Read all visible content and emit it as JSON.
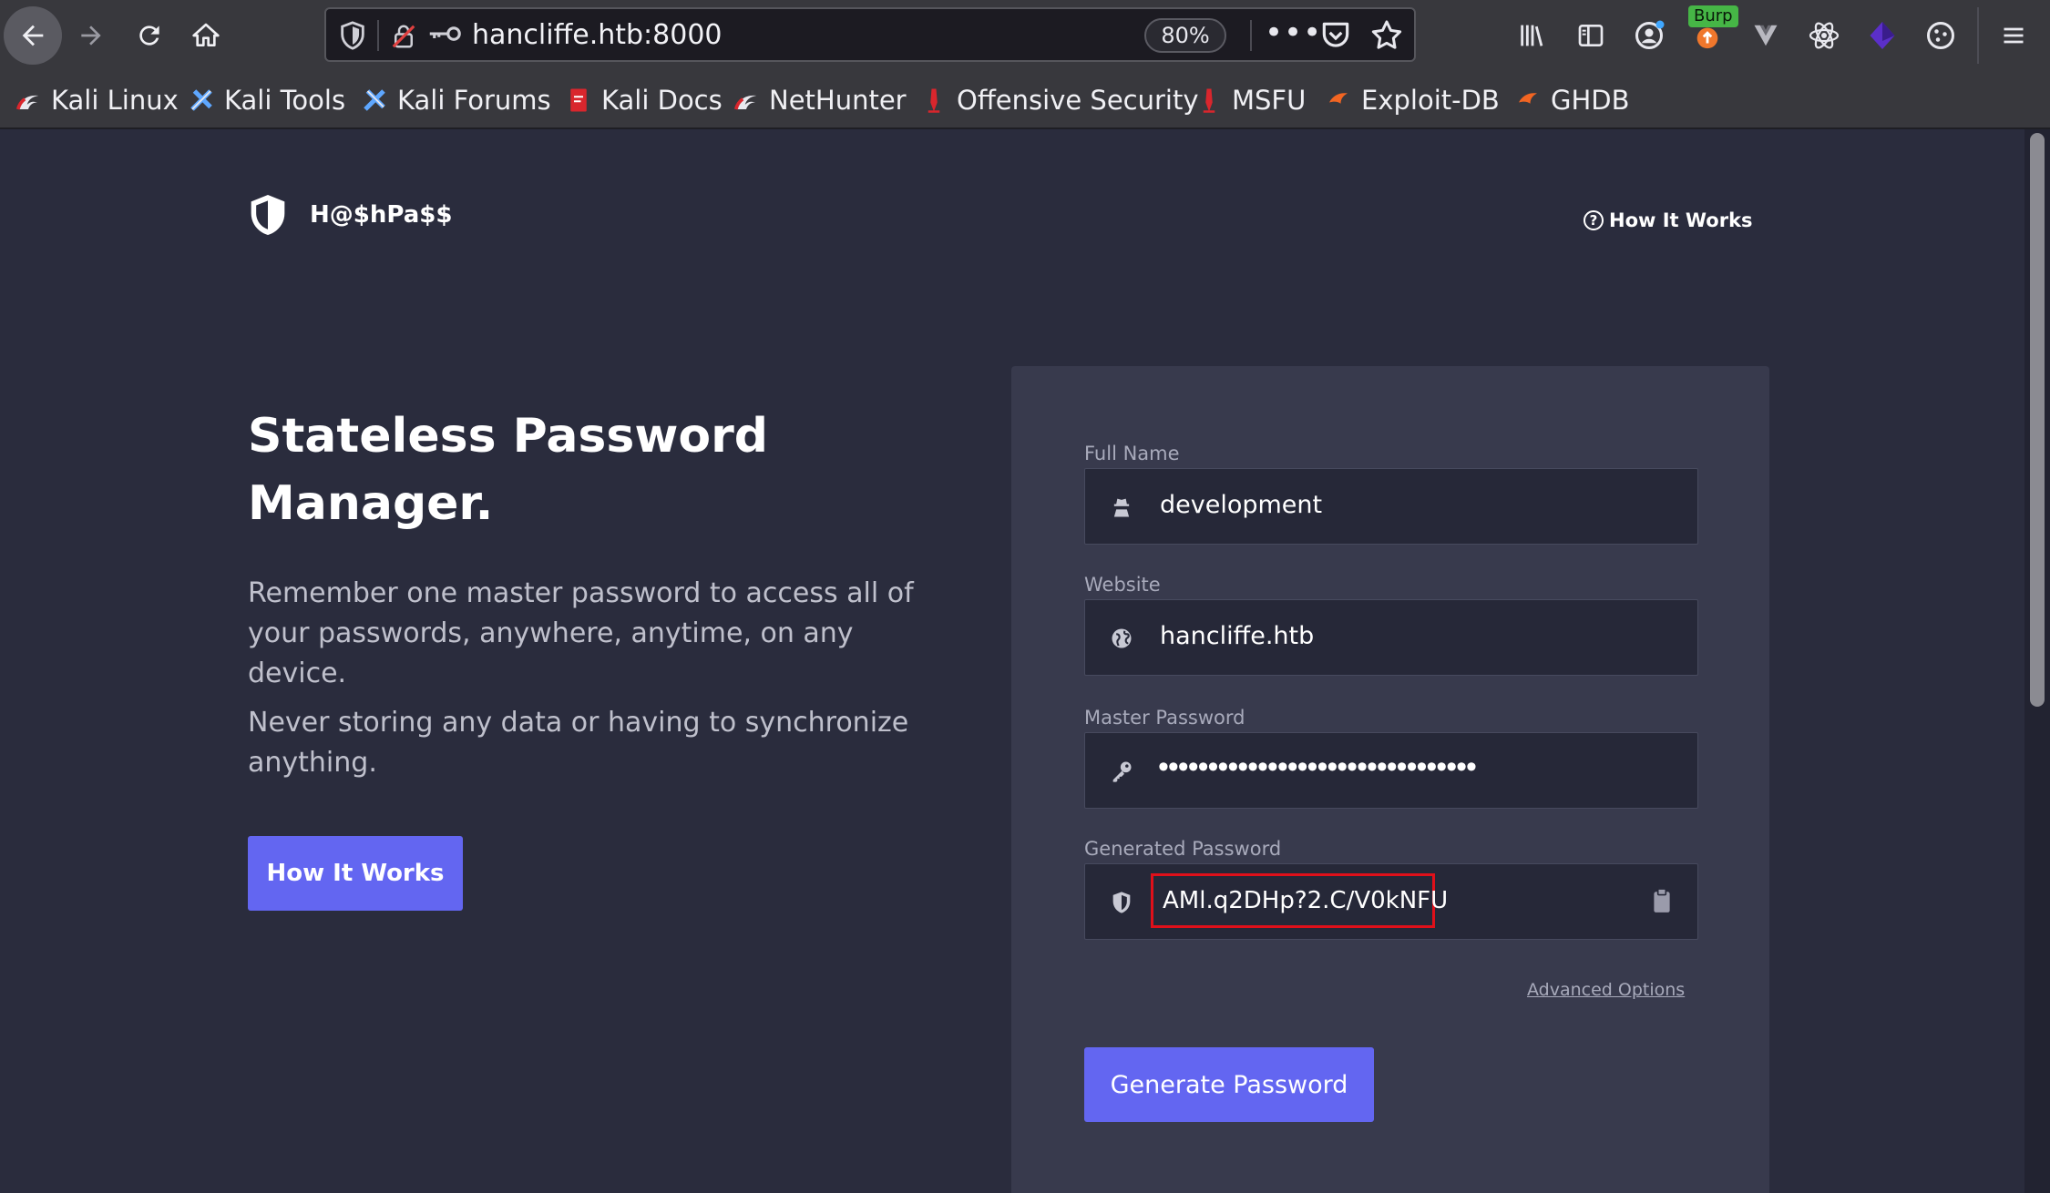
{
  "browser": {
    "url": "hancliffe.htb:8000",
    "zoom": "80%",
    "burp_badge": "Burp",
    "bookmarks": [
      {
        "label": "Kali Linux",
        "icon": "kali-dragon-icon"
      },
      {
        "label": "Kali Tools",
        "icon": "kali-tools-icon"
      },
      {
        "label": "Kali Forums",
        "icon": "kali-forums-icon"
      },
      {
        "label": "Kali Docs",
        "icon": "kali-docs-icon"
      },
      {
        "label": "NetHunter",
        "icon": "nethunter-icon"
      },
      {
        "label": "Offensive Security",
        "icon": "offsec-icon"
      },
      {
        "label": "MSFU",
        "icon": "msfu-icon"
      },
      {
        "label": "Exploit-DB",
        "icon": "exploit-db-icon"
      },
      {
        "label": "GHDB",
        "icon": "ghdb-icon"
      }
    ]
  },
  "site": {
    "logo_text": "H@$hPa$$",
    "nav_how_it_works": "How It Works"
  },
  "hero": {
    "headline_line1": "Stateless Password",
    "headline_line2": "Manager.",
    "paragraph1": "Remember one master password to access all of your passwords, anywhere, anytime, on any device.",
    "paragraph2": "Never storing any data or having to synchronize anything.",
    "button_label": "How It Works"
  },
  "form": {
    "full_name_label": "Full Name",
    "full_name_value": "development",
    "website_label": "Website",
    "website_value": "hancliffe.htb",
    "master_password_label": "Master Password",
    "master_password_mask": "••••••••••••••••••••••••••••••••",
    "generated_password_label": "Generated Password",
    "generated_password_value": "AMl.q2DHp?2.C/V0kNFU",
    "advanced_options": "Advanced Options",
    "generate_button": "Generate Password"
  },
  "colors": {
    "page_bg": "#2a2c3d",
    "card_bg": "#383a4d",
    "accent": "#6366f1",
    "highlight_border": "#e0101a"
  }
}
